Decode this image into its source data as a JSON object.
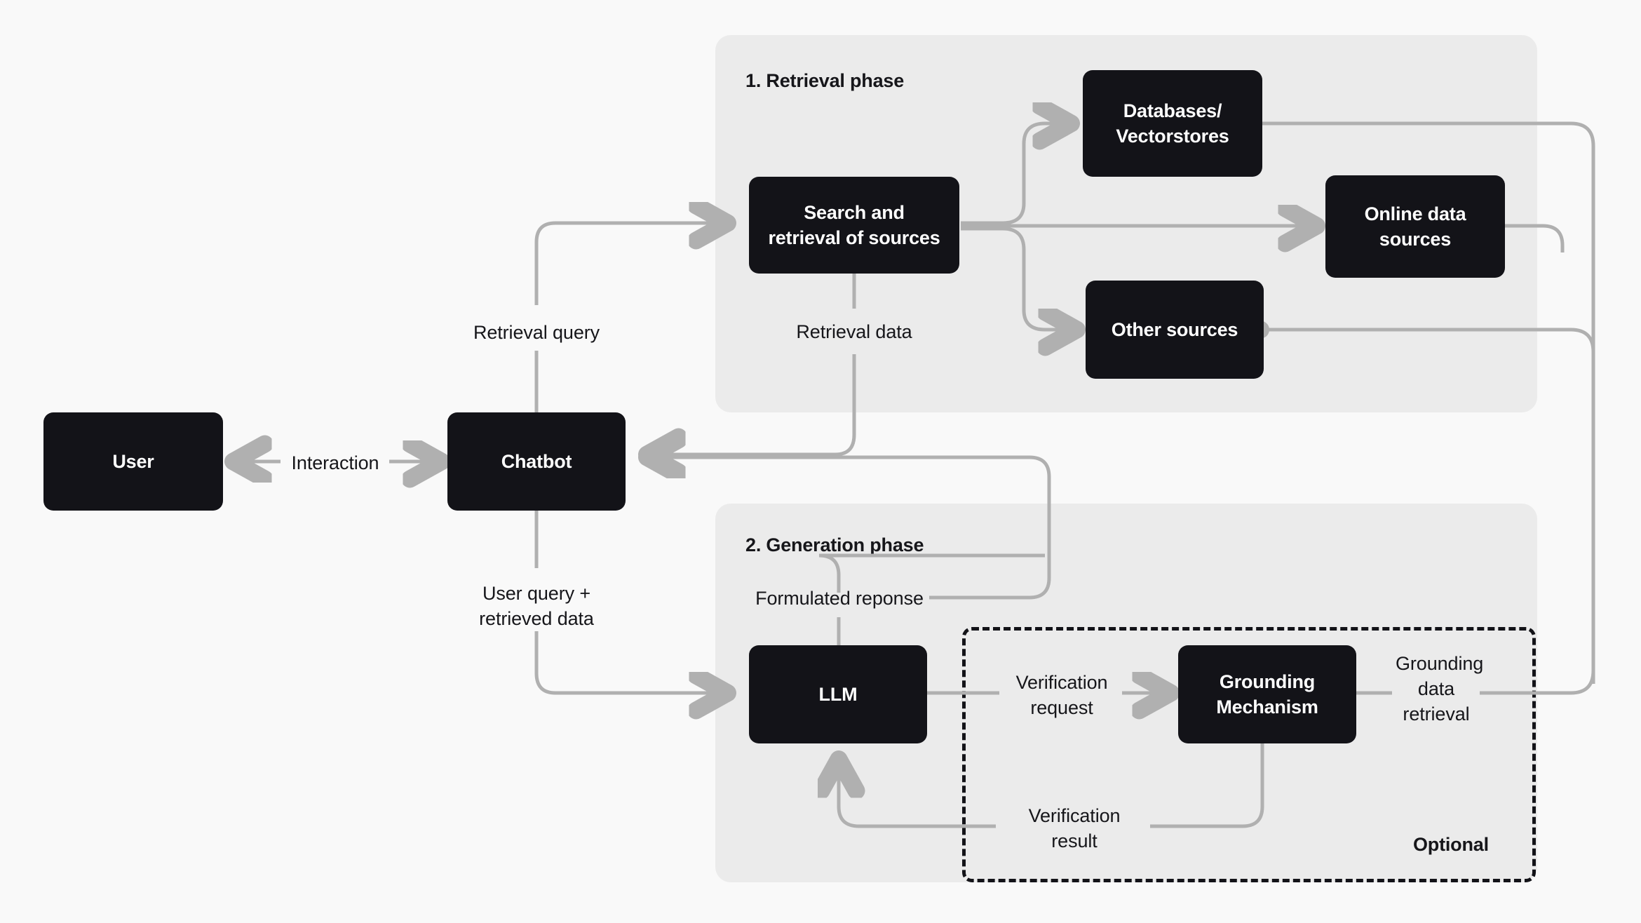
{
  "canvas": {
    "background": "#f9f9f9",
    "panel_background": "#ebebeb",
    "node_background": "#131318",
    "node_text_color": "#ffffff",
    "wire_color": "#b0b0b0",
    "text_color": "#16161a"
  },
  "phases": [
    {
      "title": "1. Retrieval phase"
    },
    {
      "title": "2. Generation phase"
    }
  ],
  "nodes": {
    "user": "User",
    "chatbot": "Chatbot",
    "search_retrieval": "Search and\nretrieval of sources",
    "databases": "Databases/\nVectorstores",
    "online_sources": "Online data\nsources",
    "other_sources": "Other sources",
    "llm": "LLM",
    "grounding": "Grounding\nMechanism"
  },
  "edge_labels": {
    "interaction": "Interaction",
    "retrieval_query": "Retrieval query",
    "retrieval_data": "Retrieval data",
    "user_query_retrieved_data": "User query +\nretrieved data",
    "formulated_response": "Formulated reponse",
    "verification_request": "Verification\nrequest",
    "verification_result": "Verification\nresult",
    "grounding_data_retrieval": "Grounding\ndata\nretrieval"
  },
  "annotations": {
    "optional": "Optional"
  }
}
